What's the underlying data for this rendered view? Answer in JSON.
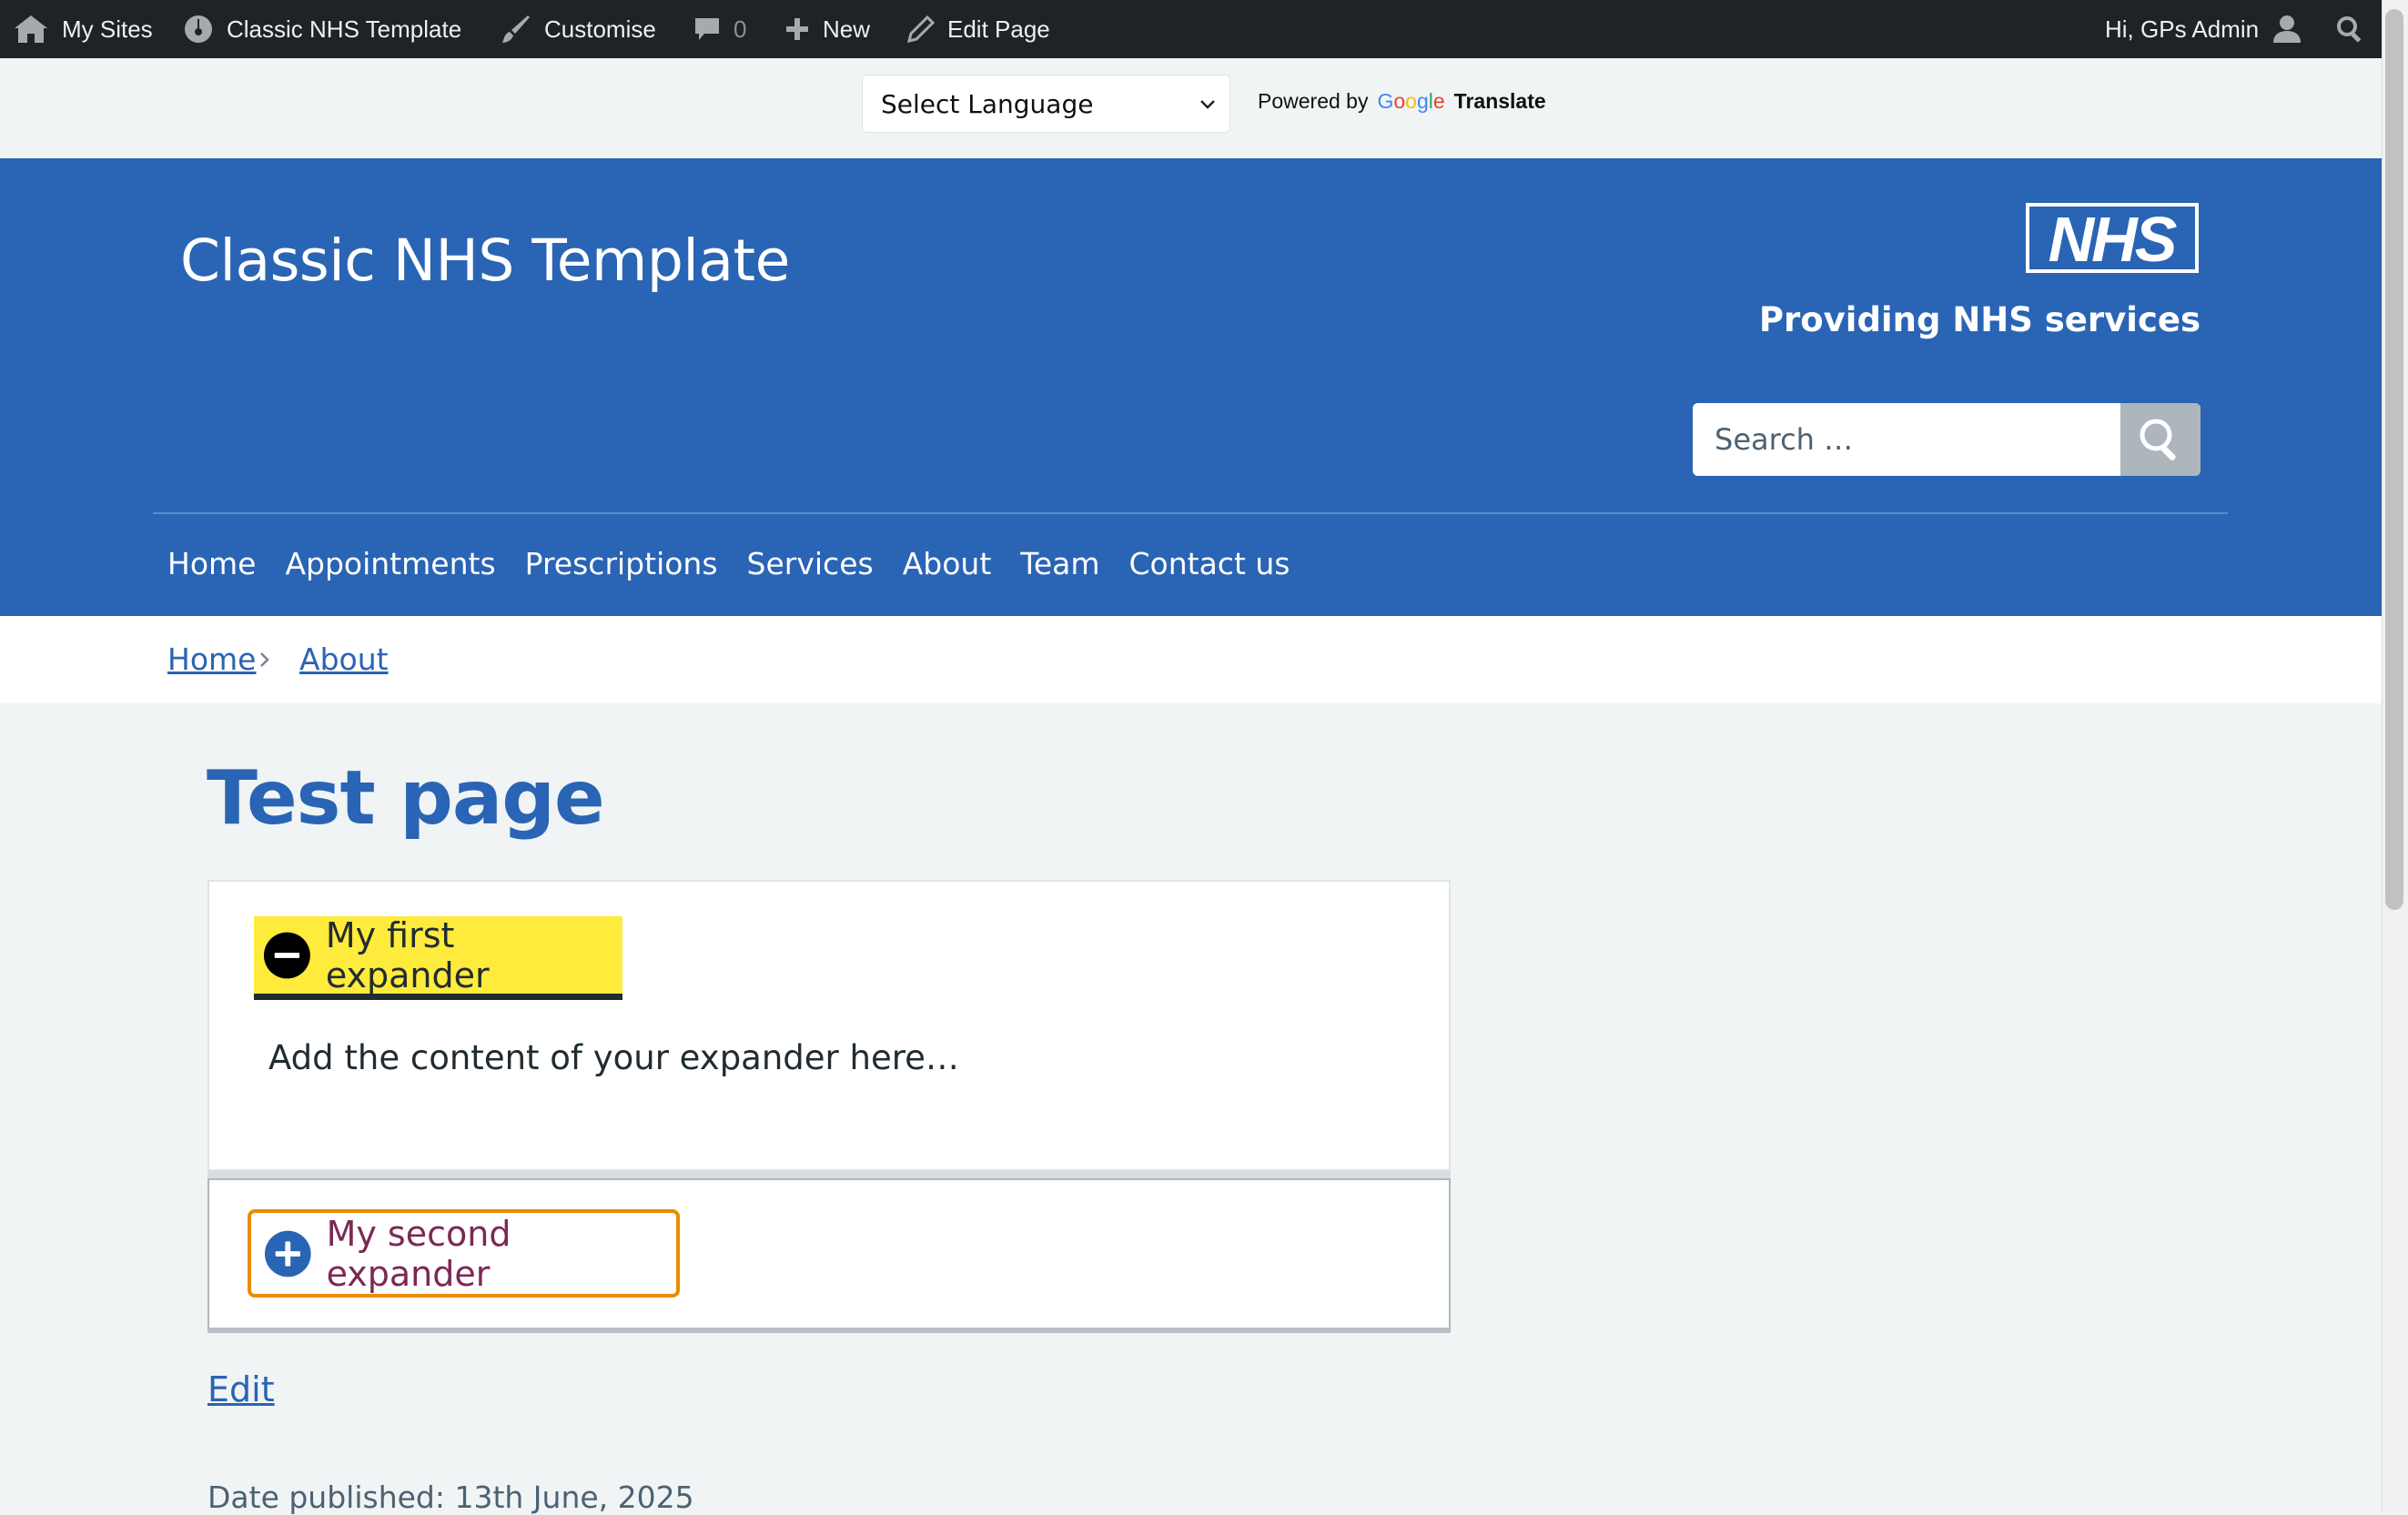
{
  "admin_bar": {
    "my_sites": "My Sites",
    "site_name": "Classic NHS Template",
    "customise": "Customise",
    "comments_count": "0",
    "new": "New",
    "edit_page": "Edit Page",
    "greeting": "Hi, GPs Admin",
    "icons": [
      "my-sites-icon",
      "dashboard-icon",
      "brush-icon",
      "comment-icon",
      "plus-icon",
      "pencil-icon",
      "user-avatar-icon",
      "search-icon"
    ]
  },
  "translate": {
    "select_label": "Select Language",
    "powered_by": "Powered by",
    "google": "Google",
    "translate": "Translate"
  },
  "header": {
    "site_title": "Classic NHS Template",
    "logo_text": "NHS",
    "tagline": "Providing NHS services",
    "search_placeholder": "Search …",
    "nav": [
      "Home",
      "Appointments",
      "Prescriptions",
      "Services",
      "About",
      "Team",
      "Contact us"
    ],
    "colors": {
      "header_bg": "#2a64b4",
      "logo_bg": "#ffffff",
      "search_btn": "#adb5bd"
    }
  },
  "breadcrumb": {
    "items": [
      "Home",
      "About"
    ]
  },
  "main": {
    "page_title": "Test page",
    "expanders": [
      {
        "label": "My first expander",
        "state": "open",
        "content": "Add the content of your expander here…"
      },
      {
        "label": "My second expander",
        "state": "closed"
      }
    ],
    "edit_link": "Edit",
    "date_published": "Date published: 13th June, 2025",
    "colors": {
      "focus_yellow": "#ffeb3b",
      "focus_orange": "#ed8b00",
      "link": "#2a64b4",
      "visited": "#7c2855"
    }
  }
}
